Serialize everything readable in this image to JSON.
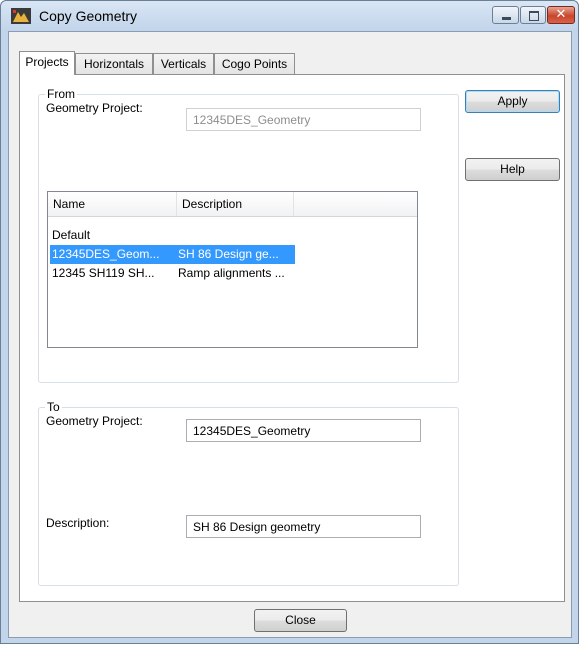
{
  "window": {
    "title": "Copy Geometry"
  },
  "tabs": [
    {
      "label": "Projects"
    },
    {
      "label": "Horizontals"
    },
    {
      "label": "Verticals"
    },
    {
      "label": "Cogo Points"
    }
  ],
  "from": {
    "group_label": "From",
    "geometry_project_label": "Geometry Project:",
    "geometry_project_value": "12345DES_Geometry",
    "list": {
      "columns": [
        "Name",
        "Description"
      ],
      "rows": [
        {
          "name": "Default",
          "description": ""
        },
        {
          "name": "12345DES_Geom...",
          "description": "SH 86 Design ge..."
        },
        {
          "name": "12345 SH119 SH...",
          "description": "Ramp alignments ..."
        }
      ]
    }
  },
  "to": {
    "group_label": "To",
    "geometry_project_label": "Geometry Project:",
    "geometry_project_value": "12345DES_Geometry",
    "description_label": "Description:",
    "description_value": "SH 86 Design geometry"
  },
  "buttons": {
    "apply": "Apply",
    "help": "Help",
    "close": "Close"
  }
}
